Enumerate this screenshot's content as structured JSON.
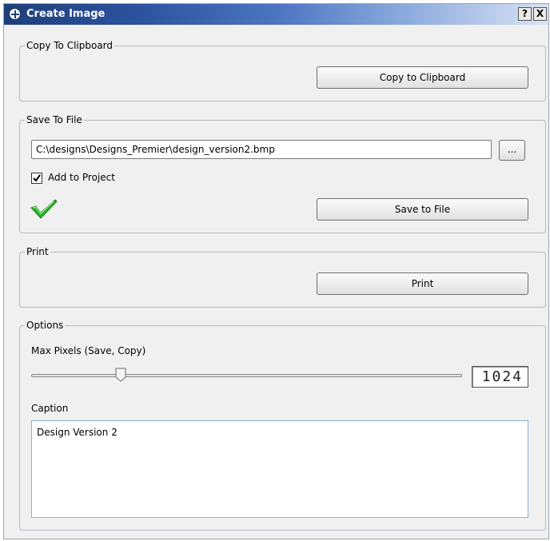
{
  "window": {
    "title": "Create Image",
    "help_label": "?",
    "close_label": "X"
  },
  "copy_group": {
    "label": "Copy To Clipboard",
    "button_label": "Copy to Clipboard"
  },
  "save_group": {
    "label": "Save To File",
    "path_value": "C:\\designs\\Designs_Premier\\design_version2.bmp",
    "browse_label": "...",
    "add_to_project_label": "Add to Project",
    "add_to_project_checked": true,
    "status_icon": "green-checkmark",
    "button_label": "Save to File"
  },
  "print_group": {
    "label": "Print",
    "button_label": "Print"
  },
  "options_group": {
    "label": "Options",
    "max_pixels_label": "Max Pixels (Save, Copy)",
    "max_pixels_value": "1024",
    "slider_fraction": 0.2,
    "caption_label": "Caption",
    "caption_value": "Design Version 2"
  },
  "colors": {
    "title_start": "#1f3f7a",
    "title_end": "#d7e3f5",
    "check_green": "#2bb52b"
  }
}
